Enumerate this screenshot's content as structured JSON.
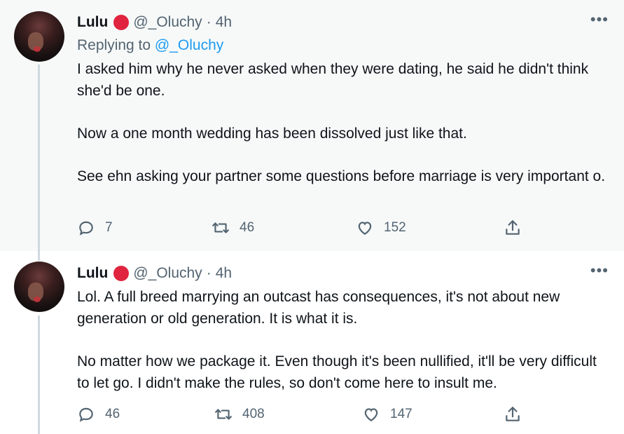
{
  "tweets": [
    {
      "name": "Lulu",
      "handle": "@_Oluchy",
      "time": "4h",
      "replying_prefix": "Replying to",
      "replying_to": "@_Oluchy",
      "paragraphs": [
        "I asked him why he never asked when they were dating, he said he didn't think she'd be one.",
        "Now a one month wedding has been dissolved just like that.",
        "See ehn asking your partner some questions before marriage is very important o."
      ],
      "replies": "7",
      "retweets": "46",
      "likes": "152"
    },
    {
      "name": "Lulu",
      "handle": "@_Oluchy",
      "time": "4h",
      "paragraphs": [
        "Lol. A full breed marrying an outcast has consequences, it's not about new generation or old generation. It is what it is.",
        "No matter how we package it. Even though it's been nullified, it'll be very difficult to let go. I didn't make the rules, so don't come here to insult me."
      ],
      "replies": "46",
      "retweets": "408",
      "likes": "147"
    }
  ],
  "icons": {
    "badge_color": "#e0243f",
    "link_color": "#1d9bf0",
    "muted_color": "#536471"
  },
  "more_glyph": "•••",
  "time_separator": "·"
}
